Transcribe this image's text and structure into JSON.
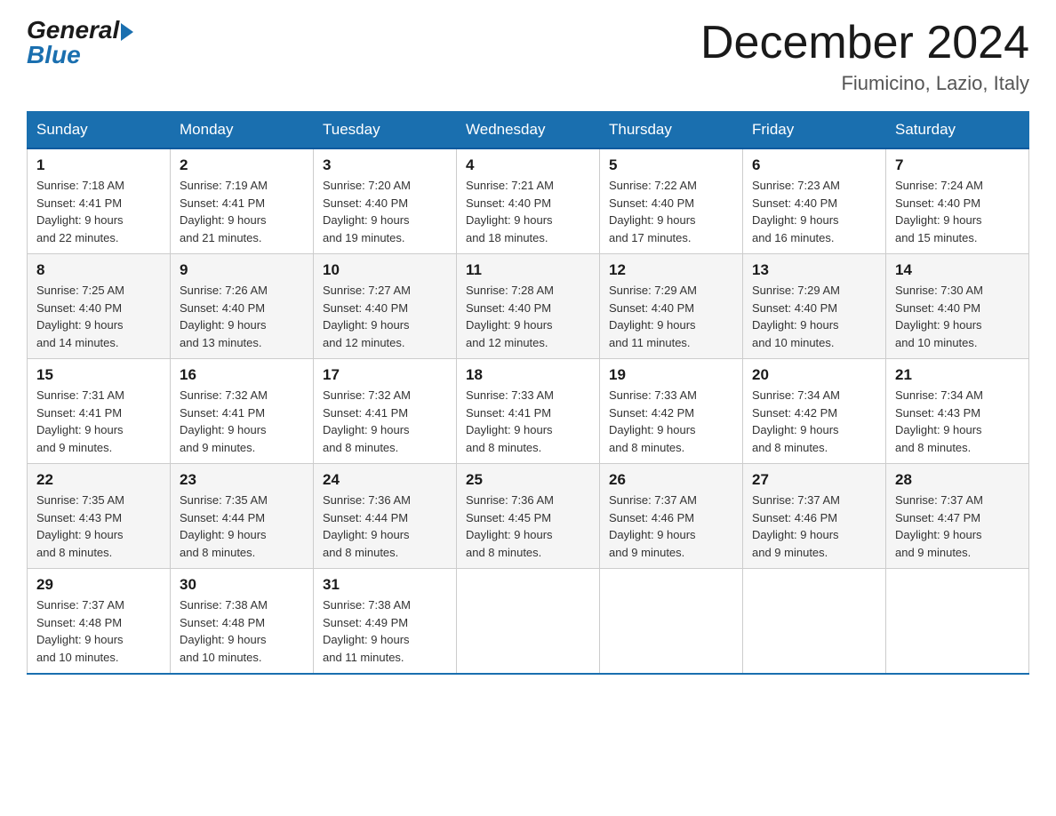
{
  "header": {
    "logo_general": "General",
    "logo_blue": "Blue",
    "month_title": "December 2024",
    "location": "Fiumicino, Lazio, Italy"
  },
  "days_of_week": [
    "Sunday",
    "Monday",
    "Tuesday",
    "Wednesday",
    "Thursday",
    "Friday",
    "Saturday"
  ],
  "weeks": [
    [
      {
        "day": "1",
        "sunrise": "7:18 AM",
        "sunset": "4:41 PM",
        "daylight": "9 hours and 22 minutes."
      },
      {
        "day": "2",
        "sunrise": "7:19 AM",
        "sunset": "4:41 PM",
        "daylight": "9 hours and 21 minutes."
      },
      {
        "day": "3",
        "sunrise": "7:20 AM",
        "sunset": "4:40 PM",
        "daylight": "9 hours and 19 minutes."
      },
      {
        "day": "4",
        "sunrise": "7:21 AM",
        "sunset": "4:40 PM",
        "daylight": "9 hours and 18 minutes."
      },
      {
        "day": "5",
        "sunrise": "7:22 AM",
        "sunset": "4:40 PM",
        "daylight": "9 hours and 17 minutes."
      },
      {
        "day": "6",
        "sunrise": "7:23 AM",
        "sunset": "4:40 PM",
        "daylight": "9 hours and 16 minutes."
      },
      {
        "day": "7",
        "sunrise": "7:24 AM",
        "sunset": "4:40 PM",
        "daylight": "9 hours and 15 minutes."
      }
    ],
    [
      {
        "day": "8",
        "sunrise": "7:25 AM",
        "sunset": "4:40 PM",
        "daylight": "9 hours and 14 minutes."
      },
      {
        "day": "9",
        "sunrise": "7:26 AM",
        "sunset": "4:40 PM",
        "daylight": "9 hours and 13 minutes."
      },
      {
        "day": "10",
        "sunrise": "7:27 AM",
        "sunset": "4:40 PM",
        "daylight": "9 hours and 12 minutes."
      },
      {
        "day": "11",
        "sunrise": "7:28 AM",
        "sunset": "4:40 PM",
        "daylight": "9 hours and 12 minutes."
      },
      {
        "day": "12",
        "sunrise": "7:29 AM",
        "sunset": "4:40 PM",
        "daylight": "9 hours and 11 minutes."
      },
      {
        "day": "13",
        "sunrise": "7:29 AM",
        "sunset": "4:40 PM",
        "daylight": "9 hours and 10 minutes."
      },
      {
        "day": "14",
        "sunrise": "7:30 AM",
        "sunset": "4:40 PM",
        "daylight": "9 hours and 10 minutes."
      }
    ],
    [
      {
        "day": "15",
        "sunrise": "7:31 AM",
        "sunset": "4:41 PM",
        "daylight": "9 hours and 9 minutes."
      },
      {
        "day": "16",
        "sunrise": "7:32 AM",
        "sunset": "4:41 PM",
        "daylight": "9 hours and 9 minutes."
      },
      {
        "day": "17",
        "sunrise": "7:32 AM",
        "sunset": "4:41 PM",
        "daylight": "9 hours and 8 minutes."
      },
      {
        "day": "18",
        "sunrise": "7:33 AM",
        "sunset": "4:41 PM",
        "daylight": "9 hours and 8 minutes."
      },
      {
        "day": "19",
        "sunrise": "7:33 AM",
        "sunset": "4:42 PM",
        "daylight": "9 hours and 8 minutes."
      },
      {
        "day": "20",
        "sunrise": "7:34 AM",
        "sunset": "4:42 PM",
        "daylight": "9 hours and 8 minutes."
      },
      {
        "day": "21",
        "sunrise": "7:34 AM",
        "sunset": "4:43 PM",
        "daylight": "9 hours and 8 minutes."
      }
    ],
    [
      {
        "day": "22",
        "sunrise": "7:35 AM",
        "sunset": "4:43 PM",
        "daylight": "9 hours and 8 minutes."
      },
      {
        "day": "23",
        "sunrise": "7:35 AM",
        "sunset": "4:44 PM",
        "daylight": "9 hours and 8 minutes."
      },
      {
        "day": "24",
        "sunrise": "7:36 AM",
        "sunset": "4:44 PM",
        "daylight": "9 hours and 8 minutes."
      },
      {
        "day": "25",
        "sunrise": "7:36 AM",
        "sunset": "4:45 PM",
        "daylight": "9 hours and 8 minutes."
      },
      {
        "day": "26",
        "sunrise": "7:37 AM",
        "sunset": "4:46 PM",
        "daylight": "9 hours and 9 minutes."
      },
      {
        "day": "27",
        "sunrise": "7:37 AM",
        "sunset": "4:46 PM",
        "daylight": "9 hours and 9 minutes."
      },
      {
        "day": "28",
        "sunrise": "7:37 AM",
        "sunset": "4:47 PM",
        "daylight": "9 hours and 9 minutes."
      }
    ],
    [
      {
        "day": "29",
        "sunrise": "7:37 AM",
        "sunset": "4:48 PM",
        "daylight": "9 hours and 10 minutes."
      },
      {
        "day": "30",
        "sunrise": "7:38 AM",
        "sunset": "4:48 PM",
        "daylight": "9 hours and 10 minutes."
      },
      {
        "day": "31",
        "sunrise": "7:38 AM",
        "sunset": "4:49 PM",
        "daylight": "9 hours and 11 minutes."
      },
      null,
      null,
      null,
      null
    ]
  ],
  "labels": {
    "sunrise": "Sunrise: ",
    "sunset": "Sunset: ",
    "daylight": "Daylight: "
  },
  "colors": {
    "header_bg": "#1a6faf",
    "accent": "#1a6faf"
  }
}
